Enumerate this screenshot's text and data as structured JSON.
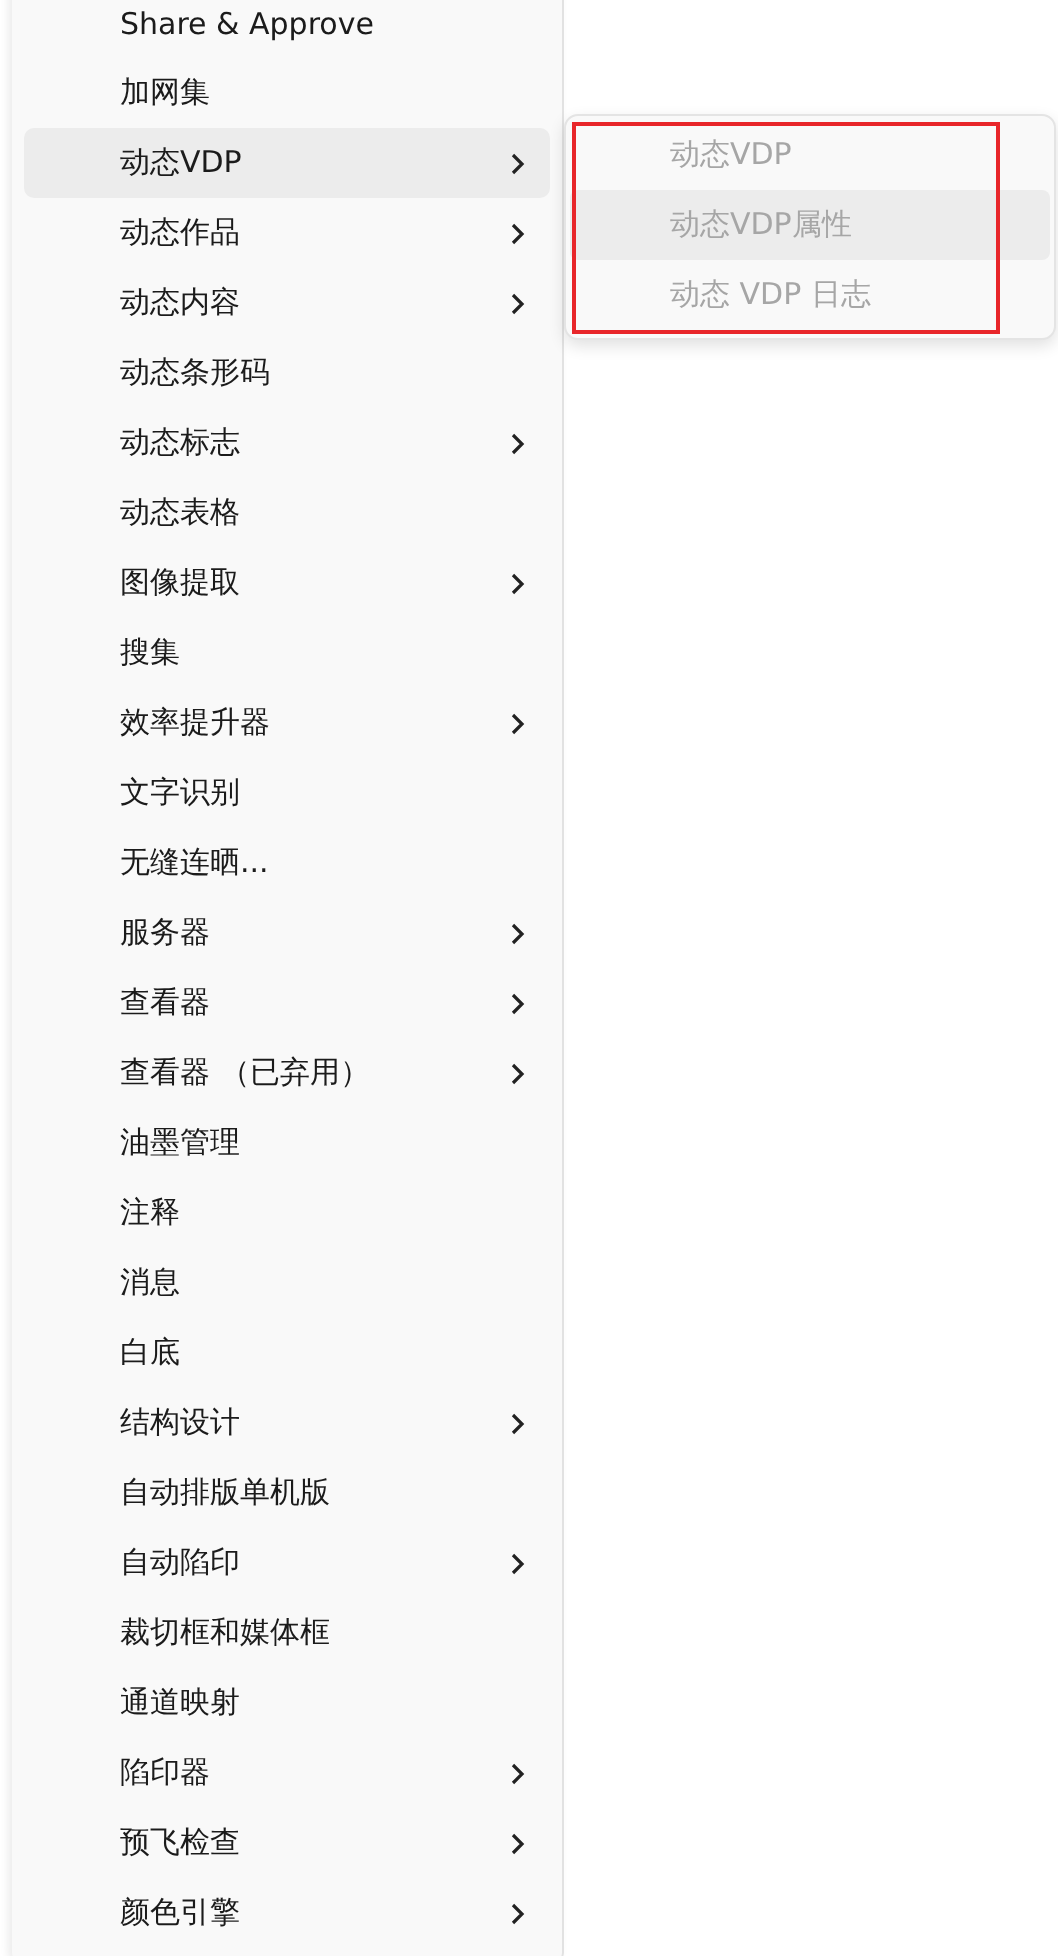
{
  "menu": {
    "items": [
      {
        "label": "Share & Approve",
        "submenu": false,
        "selected": false
      },
      {
        "label": "加网集",
        "submenu": false,
        "selected": false
      },
      {
        "label": "动态VDP",
        "submenu": true,
        "selected": true
      },
      {
        "label": "动态作品",
        "submenu": true,
        "selected": false
      },
      {
        "label": "动态内容",
        "submenu": true,
        "selected": false
      },
      {
        "label": "动态条形码",
        "submenu": false,
        "selected": false
      },
      {
        "label": "动态标志",
        "submenu": true,
        "selected": false
      },
      {
        "label": "动态表格",
        "submenu": false,
        "selected": false
      },
      {
        "label": "图像提取",
        "submenu": true,
        "selected": false
      },
      {
        "label": "搜集",
        "submenu": false,
        "selected": false
      },
      {
        "label": "效率提升器",
        "submenu": true,
        "selected": false
      },
      {
        "label": "文字识别",
        "submenu": false,
        "selected": false
      },
      {
        "label": "无缝连晒...",
        "submenu": false,
        "selected": false
      },
      {
        "label": "服务器",
        "submenu": true,
        "selected": false
      },
      {
        "label": "查看器",
        "submenu": true,
        "selected": false
      },
      {
        "label": "查看器 （已弃用）",
        "submenu": true,
        "selected": false
      },
      {
        "label": "油墨管理",
        "submenu": false,
        "selected": false
      },
      {
        "label": "注释",
        "submenu": false,
        "selected": false
      },
      {
        "label": "消息",
        "submenu": false,
        "selected": false
      },
      {
        "label": "白底",
        "submenu": false,
        "selected": false
      },
      {
        "label": "结构设计",
        "submenu": true,
        "selected": false
      },
      {
        "label": "自动排版单机版",
        "submenu": false,
        "selected": false
      },
      {
        "label": "自动陷印",
        "submenu": true,
        "selected": false
      },
      {
        "label": "裁切框和媒体框",
        "submenu": false,
        "selected": false
      },
      {
        "label": "通道映射",
        "submenu": false,
        "selected": false
      },
      {
        "label": "陷印器",
        "submenu": true,
        "selected": false
      },
      {
        "label": "预飞检查",
        "submenu": true,
        "selected": false
      },
      {
        "label": "颜色引擎",
        "submenu": true,
        "selected": false
      }
    ]
  },
  "submenu": {
    "items": [
      {
        "label": "动态VDP",
        "disabled": true,
        "selected": false
      },
      {
        "label": "动态VDP属性",
        "disabled": true,
        "selected": true
      },
      {
        "label": "动态 VDP 日志",
        "disabled": true,
        "selected": false
      }
    ]
  }
}
